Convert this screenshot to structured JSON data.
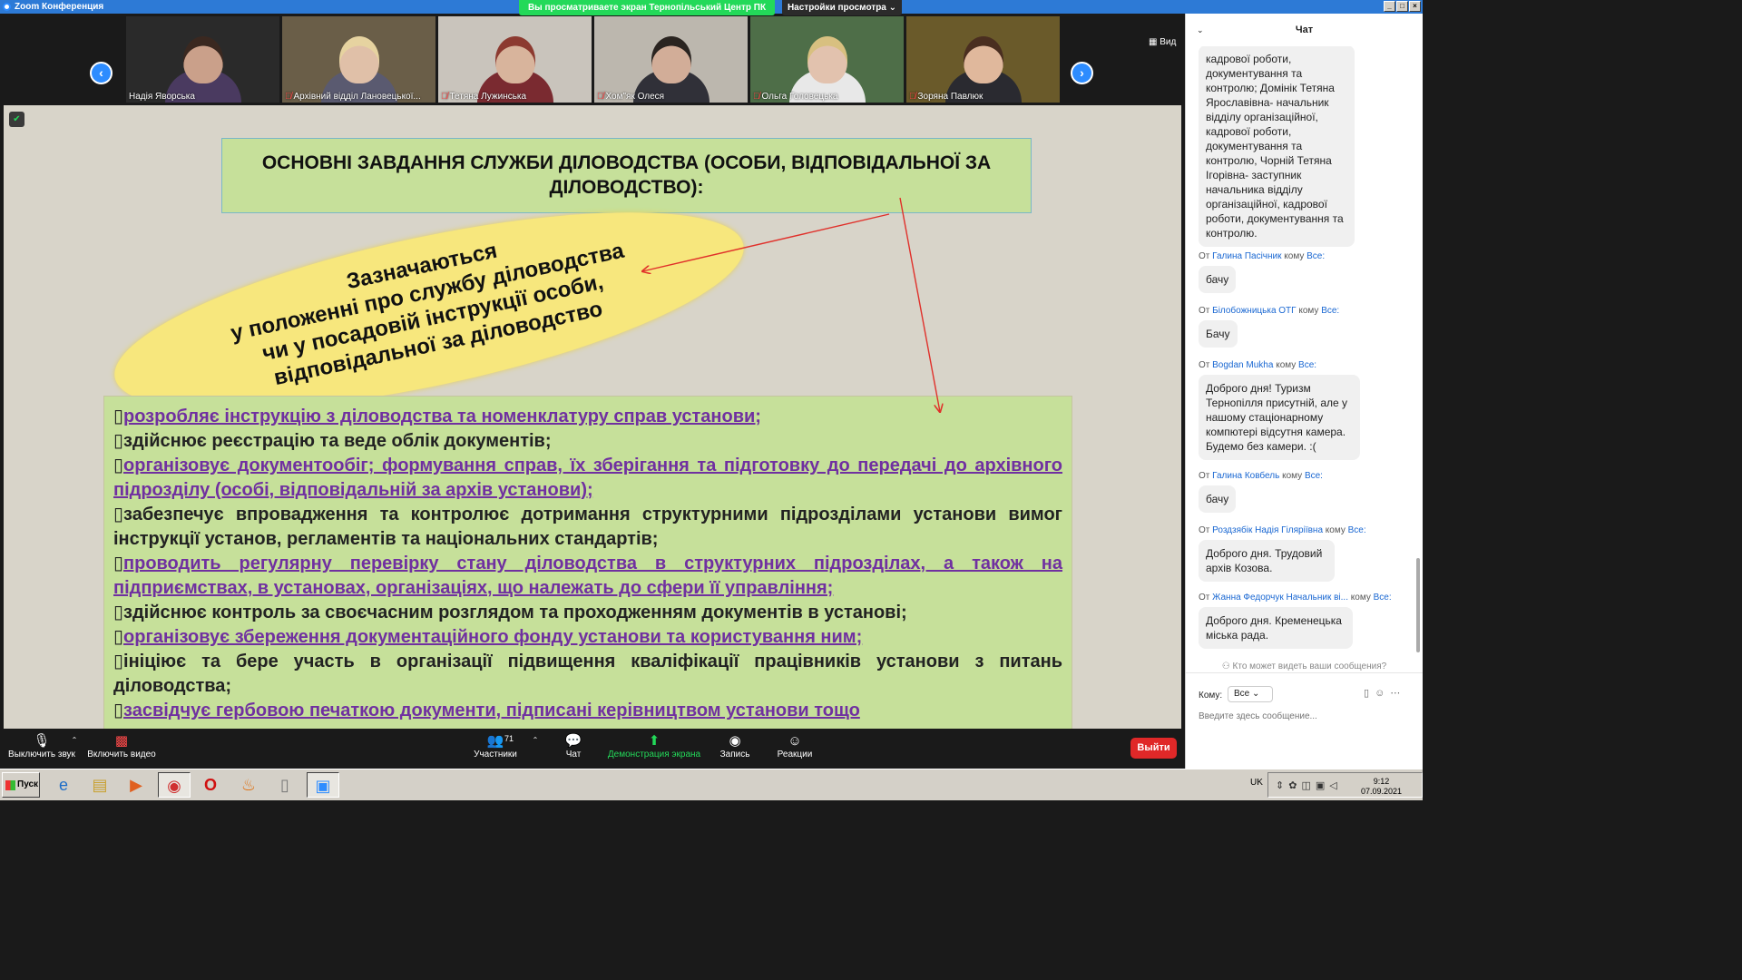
{
  "window": {
    "title": "Zoom Конференция"
  },
  "banner": {
    "sharing_text": "Вы просматриваете экран Тернопільський Центр ПК",
    "view_options": "Настройки просмотра ⌄"
  },
  "view_button": "Вид",
  "participants": [
    {
      "name": "Надія Яворська",
      "muted": false,
      "bg": "#2a2a2a",
      "face": "#caa08a",
      "hair": "#3a2820",
      "shirt": "#4a3a60"
    },
    {
      "name": "Архівний відділ Лановецької...",
      "muted": true,
      "bg": "#6a5e48",
      "face": "#e0c0a8",
      "hair": "#e6d3a0",
      "shirt": "#5a5a70"
    },
    {
      "name": "Тетяна Лужинська",
      "muted": true,
      "bg": "#c9c4bc",
      "face": "#d8b49c",
      "hair": "#8c3a30",
      "shirt": "#7a2a30"
    },
    {
      "name": "Хом\"як Олеся",
      "muted": true,
      "bg": "#bcb7ae",
      "face": "#d2ad98",
      "hair": "#2a2420",
      "shirt": "#303038"
    },
    {
      "name": "Ольга Головецька",
      "muted": true,
      "bg": "#4e6e48",
      "face": "#e2c2ae",
      "hair": "#d8c080",
      "shirt": "#e8e8e8"
    },
    {
      "name": "Зоряна Павлюк",
      "muted": true,
      "bg": "#6a5a2a",
      "face": "#e0b89c",
      "hair": "#4a2e20",
      "shirt": "#2a2a30"
    }
  ],
  "slide": {
    "title": "ОСНОВНІ ЗАВДАННЯ СЛУЖБИ ДІЛОВОДСТВА (ОСОБИ, ВІДПОВІДАЛЬНОЇ ЗА ДІЛОВОДСТВО):",
    "ellipse_lines": [
      "Зазначаються",
      "у положенні про службу діловодства",
      "чи у посадовій інструкції особи,",
      "відповідальної за діловодство"
    ],
    "tasks": [
      {
        "text": "розробляє інструкцію з діловодства та номенклатуру справ установи;",
        "highlight": true
      },
      {
        "text": "здійснює реєстрацію та веде облік документів;",
        "highlight": false
      },
      {
        "text": "організовує документообіг; формування справ, їх зберігання та підготовку до передачі до архівного підрозділу (особі, відповідальній за архів установи);",
        "highlight": true
      },
      {
        "text": "забезпечує впровадження та контролює дотримання структурними підрозділами установи вимог інструкції установ, регламентів та національних стандартів;",
        "highlight": false
      },
      {
        "text": "проводить регулярну перевірку стану діловодства в структурних підрозділах, а також на підприємствах, в установах, організаціях, що належать до сфери її управління;",
        "highlight": true
      },
      {
        "text": "здійснює контроль за своєчасним розглядом та проходженням документів в установі;",
        "highlight": false
      },
      {
        "text": "організовує збереження документаційного фонду установи та користування ним;",
        "highlight": true
      },
      {
        "text": "ініціює та бере участь в організації підвищення кваліфікації працівників установи з питань діловодства;",
        "highlight": false
      },
      {
        "text": "засвідчує гербовою печаткою документи, підписані керівництвом установи тощо",
        "highlight": true
      }
    ]
  },
  "toolbar": {
    "mute": "Выключить звук",
    "video": "Включить видео",
    "participants": "Участники",
    "participants_count": "71",
    "chat": "Чат",
    "share": "Демонстрация экрана",
    "record": "Запись",
    "reactions": "Реакции",
    "leave": "Выйти"
  },
  "chat": {
    "header": "Чат",
    "partial_message": "кадрової роботи, документування та контролю; Домінік Тетяна Ярославівна- начальник відділу організаційної, кадрової роботи, документування та контролю, Чорній Тетяна Ігорівна- заступник начальника відділу організаційної, кадрової роботи, документування та контролю.",
    "from_label": "От",
    "to_word": "кому",
    "messages": [
      {
        "sender": "Галина Пасічник",
        "to": "Все:",
        "text": "бачу"
      },
      {
        "sender": "Білобожницька ОТГ",
        "to": "Все:",
        "text": "Бачу"
      },
      {
        "sender": "Bogdan Mukha",
        "to": "Все:",
        "text": "Доброго дня!  Туризм Тернопілля присутній, але у нашому стаціонарному компютері  відсутня камера. Будемо без камери. :("
      },
      {
        "sender": "Галина Ковбель",
        "to": "Все:",
        "text": "бачу"
      },
      {
        "sender": "Роздзябік Надія Гіляріївна",
        "to": "Все:",
        "text": "Доброго дня. Трудовий архів Козова."
      },
      {
        "sender": "Жанна Федорчук Начальник ві...",
        "to": "Все:",
        "text": "Доброго дня. Кременецька міська рада."
      }
    ],
    "privacy_text": "Кто может видеть ваши сообщения?",
    "to_label": "Кому:",
    "to_value": "Все",
    "input_placeholder": "Введите здесь сообщение..."
  },
  "taskbar": {
    "start": "Пуск",
    "lang": "UK",
    "time": "9:12",
    "date": "07.09.2021"
  }
}
